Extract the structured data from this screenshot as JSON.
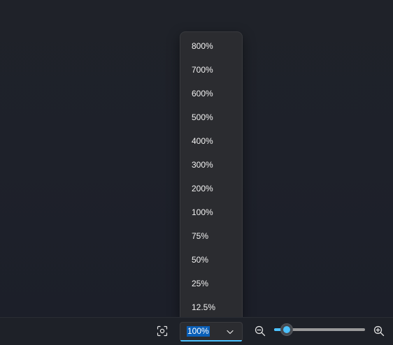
{
  "zoom": {
    "current_value": "100%",
    "options": [
      "800%",
      "700%",
      "600%",
      "500%",
      "400%",
      "300%",
      "200%",
      "100%",
      "75%",
      "50%",
      "25%",
      "12.5%"
    ],
    "slider_level": 0.14
  },
  "colors": {
    "accent": "#4cc2ff",
    "selection": "#0a5fb8",
    "background": "#1e2128",
    "flyout": "#2b2c30"
  },
  "icons": {
    "fit": "fit-to-window-icon",
    "chevron": "chevron-down-icon",
    "zoom_out": "zoom-out-icon",
    "zoom_in": "zoom-in-icon"
  }
}
